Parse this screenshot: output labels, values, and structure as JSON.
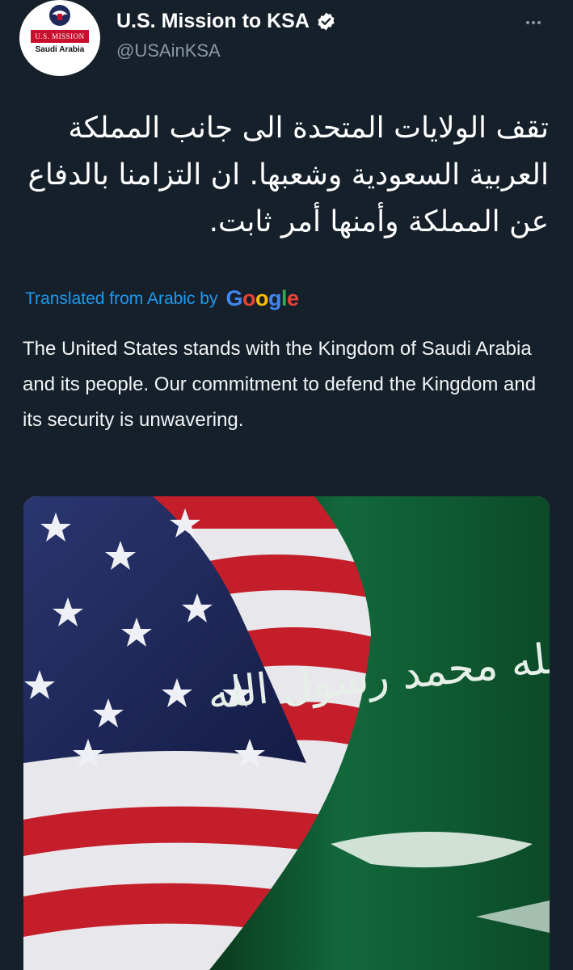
{
  "header": {
    "avatar": {
      "ribbon": "U.S. MISSION",
      "place": "Saudi Arabia"
    },
    "display_name": "U.S. Mission to KSA",
    "handle": "@USAinKSA",
    "verified_icon": "verified-badge-icon",
    "more_icon": "more-options-icon"
  },
  "tweet": {
    "arabic_text": "تقف الولايات المتحدة الى جانب المملكة العربية السعودية وشعبها. ان التزامنا بالدفاع عن المملكة وأمنها أمر ثابت.",
    "translation_label": "Translated from Arabic by",
    "translation_provider": [
      "G",
      "o",
      "o",
      "g",
      "l",
      "e"
    ],
    "english_text": "The United States stands with the Kingdom of Saudi Arabia and its people. Our commitment to defend the Kingdom and its security is unwavering."
  },
  "media": {
    "flag_text": "لا إله إلا الله محمد رسول الله",
    "colors": {
      "us_red": "#c41e2a",
      "us_blue": "#1f2a5c",
      "saudi_green": "#0f5a2e",
      "link": "#1d9bf0"
    }
  }
}
